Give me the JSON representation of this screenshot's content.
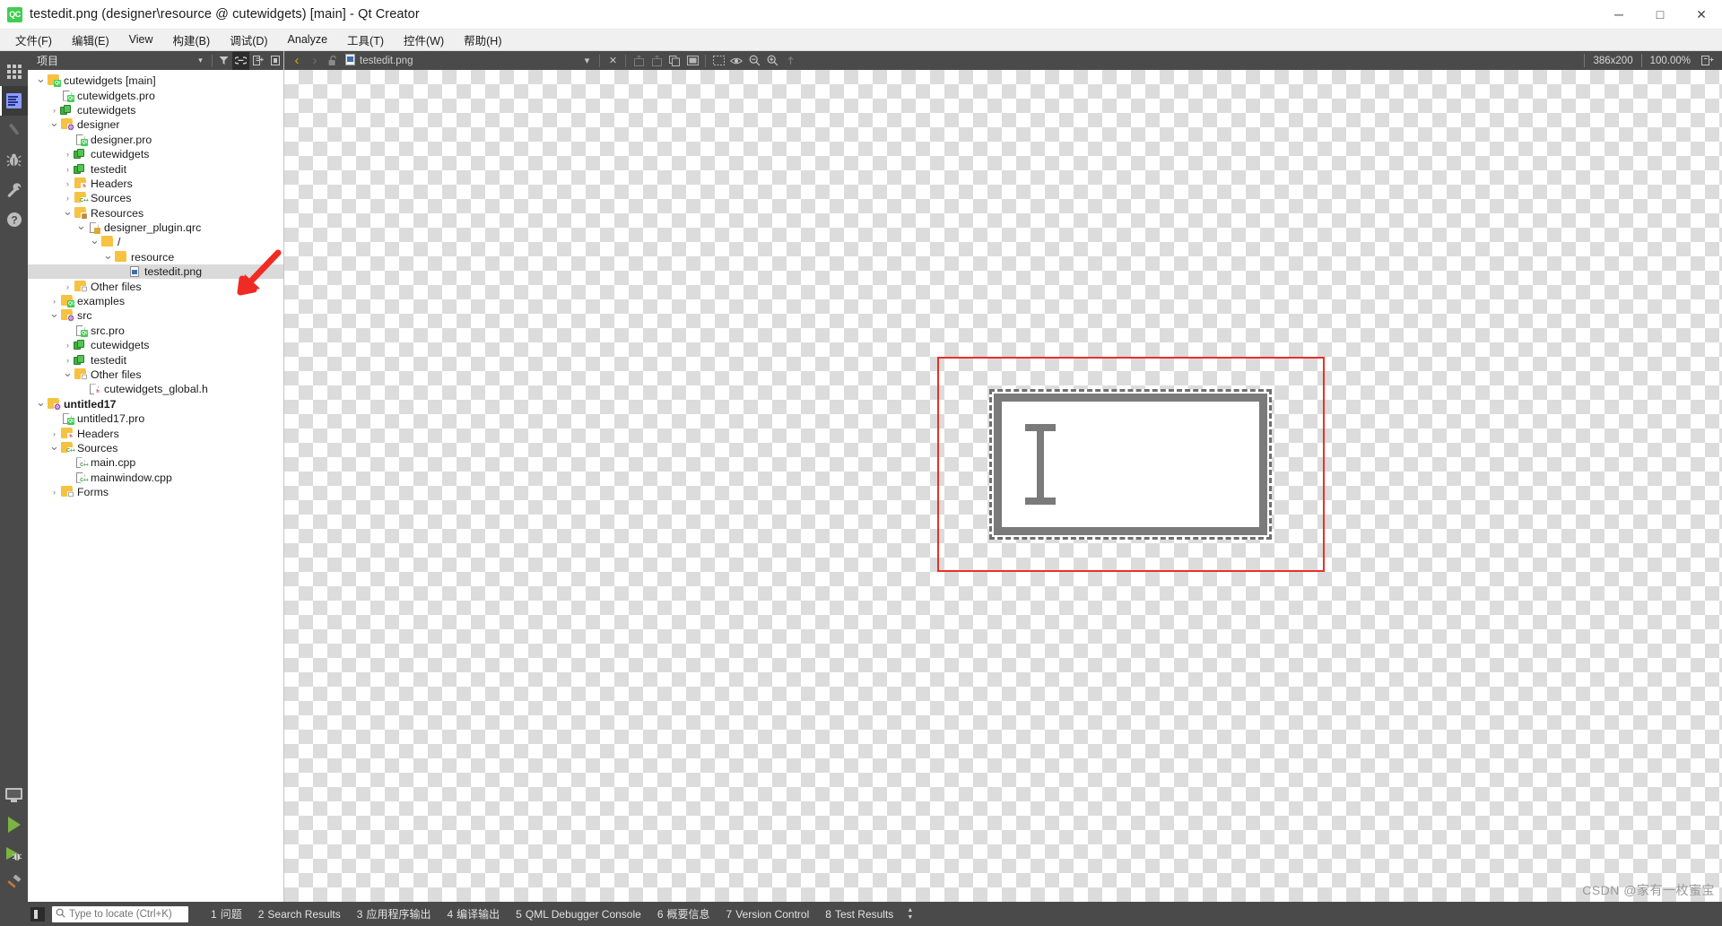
{
  "window": {
    "title": "testedit.png (designer\\resource @ cutewidgets) [main] - Qt Creator",
    "app_icon_text": "QC",
    "minimize": "─",
    "maximize": "□",
    "close": "✕"
  },
  "menubar": {
    "items": [
      {
        "label": "文件(F)",
        "name": "menu-file"
      },
      {
        "label": "编辑(E)",
        "name": "menu-edit"
      },
      {
        "label": "View",
        "name": "menu-view"
      },
      {
        "label": "构建(B)",
        "name": "menu-build"
      },
      {
        "label": "调试(D)",
        "name": "menu-debug"
      },
      {
        "label": "Analyze",
        "name": "menu-analyze"
      },
      {
        "label": "工具(T)",
        "name": "menu-tools"
      },
      {
        "label": "控件(W)",
        "name": "menu-window"
      },
      {
        "label": "帮助(H)",
        "name": "menu-help"
      }
    ]
  },
  "modebar": {
    "top_icons": [
      "grid-icon",
      "edit-document-icon",
      "design-pencil-icon",
      "debug-bug-icon",
      "projects-wrench-icon",
      "help-question-icon"
    ],
    "bottom_icons": [
      "kit-monitor-icon",
      "run-play-icon",
      "debug-play-icon",
      "build-hammer-icon"
    ],
    "active_index": 1
  },
  "project_panel": {
    "header_title": "项目",
    "header_dropdown": "▾",
    "filter_icon": "filter-icon",
    "link_icon": "link-with-editor-icon",
    "expand_icon": "expand-all-icon",
    "misc_icon": "hide-generated-icon",
    "tree": [
      {
        "label": "cutewidgets [main]",
        "depth": 0,
        "arrow": "down",
        "icon": "folder-qt",
        "bold": false,
        "selected": false
      },
      {
        "label": "cutewidgets.pro",
        "depth": 1,
        "arrow": "none",
        "icon": "file-qt",
        "bold": false,
        "selected": false
      },
      {
        "label": "cutewidgets",
        "depth": 1,
        "arrow": "right",
        "icon": "library",
        "bold": false,
        "selected": false
      },
      {
        "label": "designer",
        "depth": 1,
        "arrow": "down",
        "icon": "folder-gear",
        "bold": false,
        "selected": false
      },
      {
        "label": "designer.pro",
        "depth": 2,
        "arrow": "none",
        "icon": "file-qt",
        "bold": false,
        "selected": false
      },
      {
        "label": "cutewidgets",
        "depth": 2,
        "arrow": "right",
        "icon": "library",
        "bold": false,
        "selected": false
      },
      {
        "label": "testedit",
        "depth": 2,
        "arrow": "right",
        "icon": "library",
        "bold": false,
        "selected": false
      },
      {
        "label": "Headers",
        "depth": 2,
        "arrow": "right",
        "icon": "folder-h",
        "bold": false,
        "selected": false
      },
      {
        "label": "Sources",
        "depth": 2,
        "arrow": "right",
        "icon": "folder-cpp",
        "bold": false,
        "selected": false
      },
      {
        "label": "Resources",
        "depth": 2,
        "arrow": "down",
        "icon": "folder-res",
        "bold": false,
        "selected": false
      },
      {
        "label": "designer_plugin.qrc",
        "depth": 3,
        "arrow": "down",
        "icon": "file-qrc",
        "bold": false,
        "selected": false
      },
      {
        "label": "/",
        "depth": 4,
        "arrow": "down",
        "icon": "folder-plain",
        "bold": false,
        "selected": false
      },
      {
        "label": "resource",
        "depth": 5,
        "arrow": "down",
        "icon": "folder-plain",
        "bold": false,
        "selected": false
      },
      {
        "label": "testedit.png",
        "depth": 6,
        "arrow": "none",
        "icon": "file-image",
        "bold": false,
        "selected": true
      },
      {
        "label": "Other files",
        "depth": 2,
        "arrow": "right",
        "icon": "folder-other",
        "bold": false,
        "selected": false
      },
      {
        "label": "examples",
        "depth": 1,
        "arrow": "right",
        "icon": "folder-qt",
        "bold": false,
        "selected": false
      },
      {
        "label": "src",
        "depth": 1,
        "arrow": "down",
        "icon": "folder-gear",
        "bold": false,
        "selected": false
      },
      {
        "label": "src.pro",
        "depth": 2,
        "arrow": "none",
        "icon": "file-qt",
        "bold": false,
        "selected": false
      },
      {
        "label": "cutewidgets",
        "depth": 2,
        "arrow": "right",
        "icon": "library",
        "bold": false,
        "selected": false
      },
      {
        "label": "testedit",
        "depth": 2,
        "arrow": "right",
        "icon": "library",
        "bold": false,
        "selected": false
      },
      {
        "label": "Other files",
        "depth": 2,
        "arrow": "down",
        "icon": "folder-other",
        "bold": false,
        "selected": false
      },
      {
        "label": "cutewidgets_global.h",
        "depth": 3,
        "arrow": "none",
        "icon": "file-h",
        "bold": false,
        "selected": false
      },
      {
        "label": "untitled17",
        "depth": 0,
        "arrow": "down",
        "icon": "folder-gear",
        "bold": true,
        "selected": false
      },
      {
        "label": "untitled17.pro",
        "depth": 1,
        "arrow": "none",
        "icon": "file-qt",
        "bold": false,
        "selected": false
      },
      {
        "label": "Headers",
        "depth": 1,
        "arrow": "right",
        "icon": "folder-h",
        "bold": false,
        "selected": false
      },
      {
        "label": "Sources",
        "depth": 1,
        "arrow": "down",
        "icon": "folder-cpp",
        "bold": false,
        "selected": false
      },
      {
        "label": "main.cpp",
        "depth": 2,
        "arrow": "none",
        "icon": "file-cpp",
        "bold": false,
        "selected": false
      },
      {
        "label": "mainwindow.cpp",
        "depth": 2,
        "arrow": "none",
        "icon": "file-cpp",
        "bold": false,
        "selected": false
      },
      {
        "label": "Forms",
        "depth": 1,
        "arrow": "right",
        "icon": "folder-forms",
        "bold": false,
        "selected": false
      }
    ]
  },
  "editor_toolbar": {
    "nav_back": "‹",
    "nav_forward": "›",
    "lock_icon": "unlocked-icon",
    "file_icon": "image-file-icon",
    "filename": "testedit.png",
    "dropdown": "▾",
    "close": "✕",
    "split_icon": "split-icon",
    "split_side_icon": "split-side-icon",
    "copy_icon": "duplicate-icon",
    "fullscreen_icon": "fullscreen-icon",
    "eye_icon": "preview-eye-icon",
    "zoom_out_icon": "zoom-out-icon",
    "zoom_in_icon": "zoom-in-icon",
    "fit_icon": "fit-to-view-icon",
    "image_size": "386x200",
    "zoom_level": "100.00%",
    "zoom_fit_icon": "fit-icon"
  },
  "canvas": {
    "image_name": "testedit.png",
    "selection_color": "#e8312a",
    "border_color": "#6e6e6e",
    "cursor_glyph": "I-beam"
  },
  "statusbar": {
    "toggle_sidebar_icon": "toggle-sidebar-icon",
    "locator_icon": "search-icon",
    "locator_placeholder": "Type to locate (Ctrl+K)",
    "locator_value": "",
    "panes": [
      {
        "num": "1",
        "label": "问题"
      },
      {
        "num": "2",
        "label": "Search Results"
      },
      {
        "num": "3",
        "label": "应用程序输出"
      },
      {
        "num": "4",
        "label": "编译输出"
      },
      {
        "num": "5",
        "label": "QML Debugger Console"
      },
      {
        "num": "6",
        "label": "概要信息"
      },
      {
        "num": "7",
        "label": "Version Control"
      },
      {
        "num": "8",
        "label": "Test Results"
      }
    ]
  },
  "watermark": {
    "text": "CSDN @家有一枚蜜宝"
  }
}
